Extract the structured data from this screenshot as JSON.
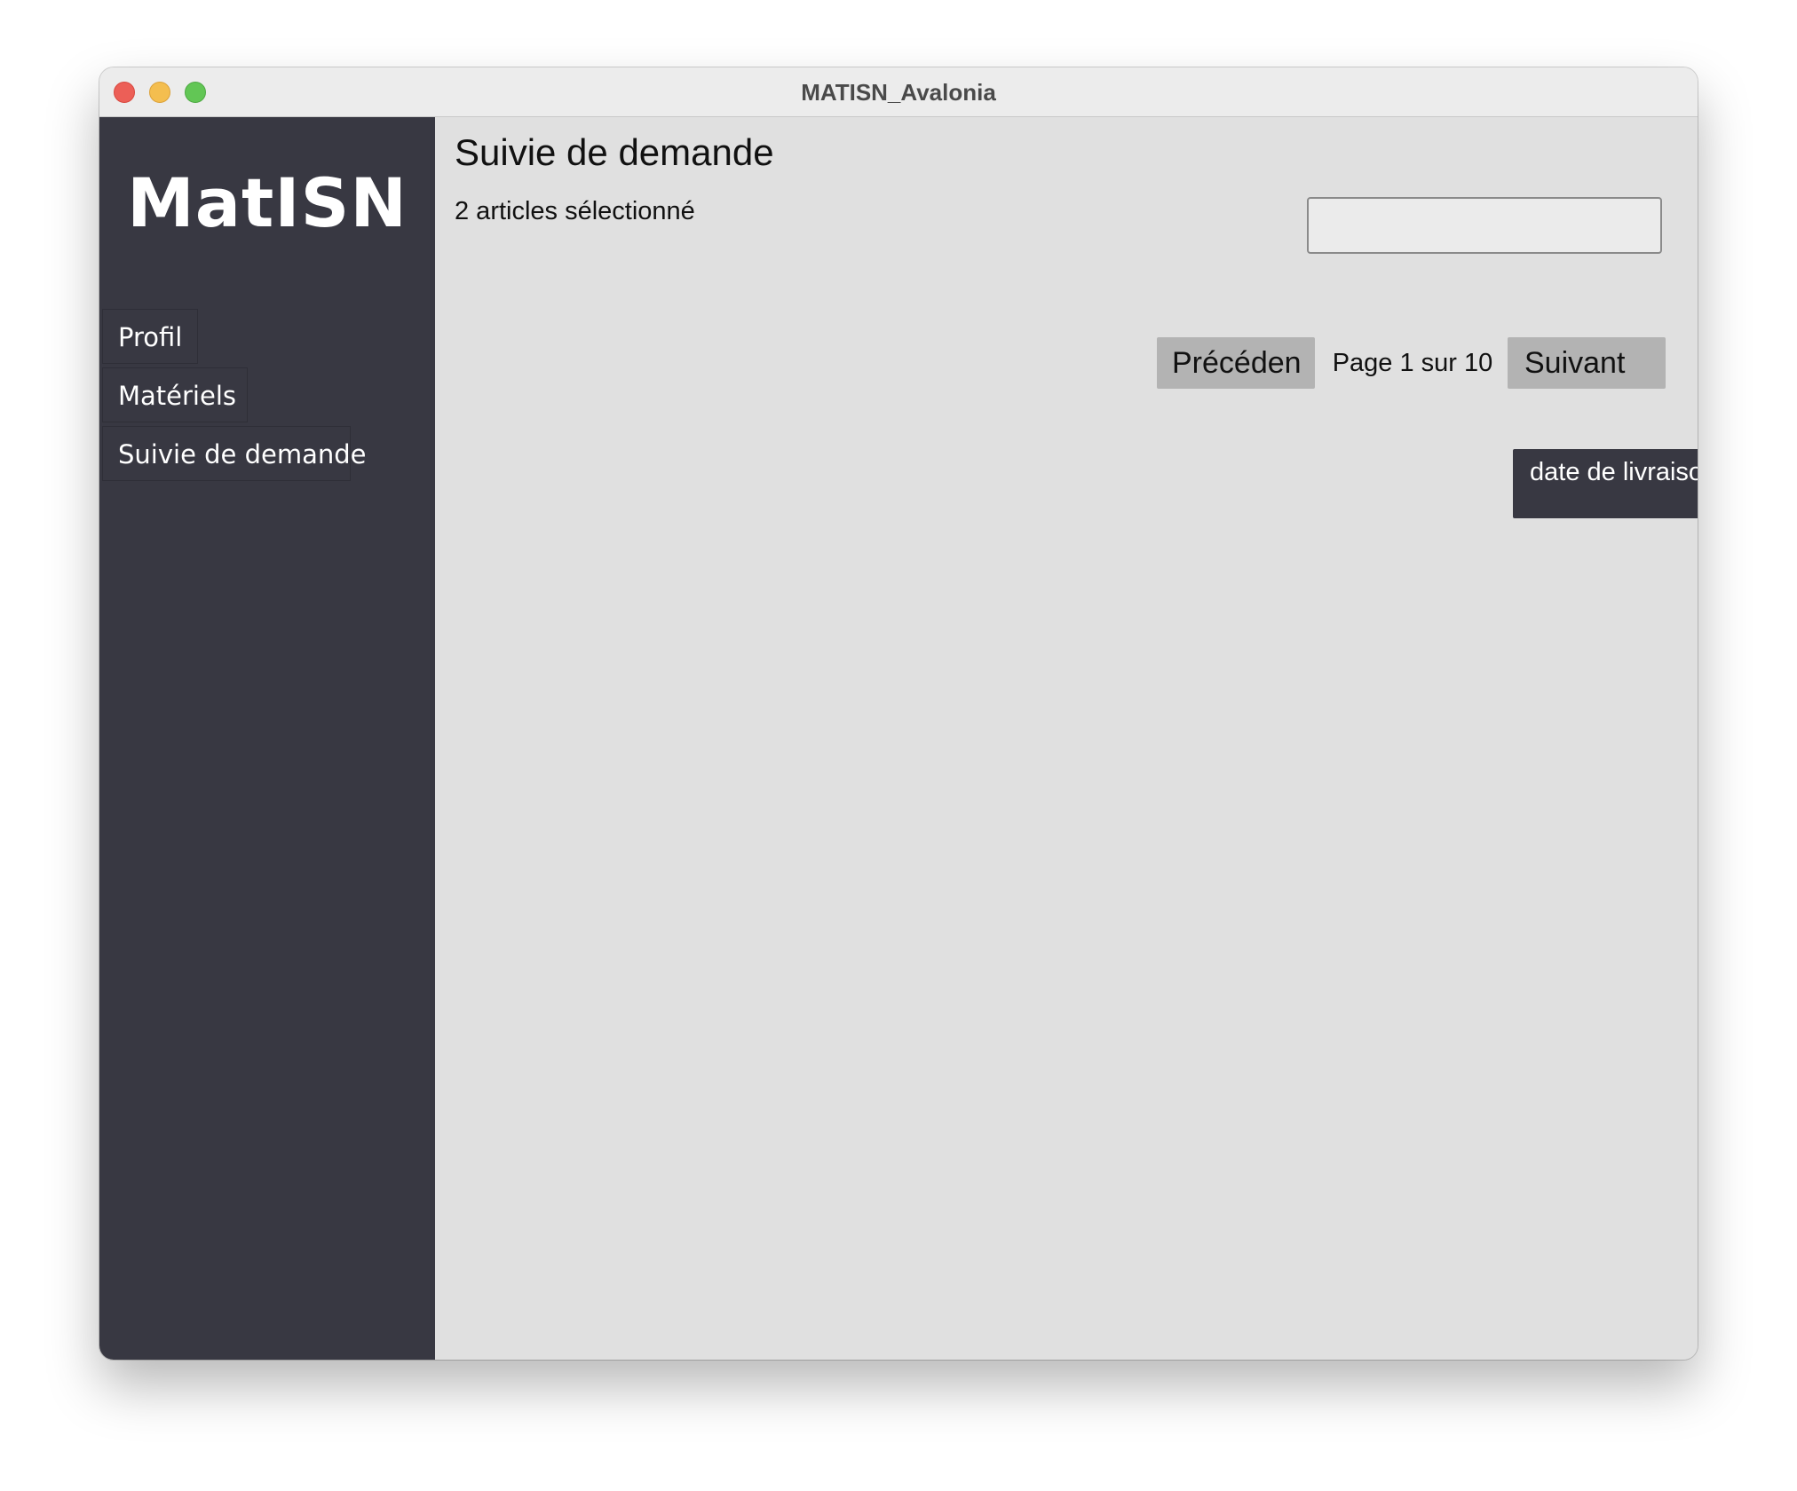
{
  "window": {
    "title": "MATISN_Avalonia"
  },
  "sidebar": {
    "logo": "MatISN",
    "items": [
      {
        "label": "Profil"
      },
      {
        "label": "Matériels"
      },
      {
        "label": "Suivie de demande"
      }
    ]
  },
  "main": {
    "title": "Suivie de demande",
    "selection_count": "2 articles sélectionné",
    "search": {
      "value": "",
      "placeholder": ""
    },
    "pagination": {
      "prev_label": "Précéden",
      "page_indicator": "Page 1 sur 10",
      "next_label": "Suivant"
    },
    "table": {
      "columns": [
        "date de livraison"
      ]
    }
  },
  "colors": {
    "sidebar_bg": "#383842",
    "content_bg": "#e0e0e0",
    "button_bg": "#b3b3b3",
    "header_bg": "#383842"
  }
}
